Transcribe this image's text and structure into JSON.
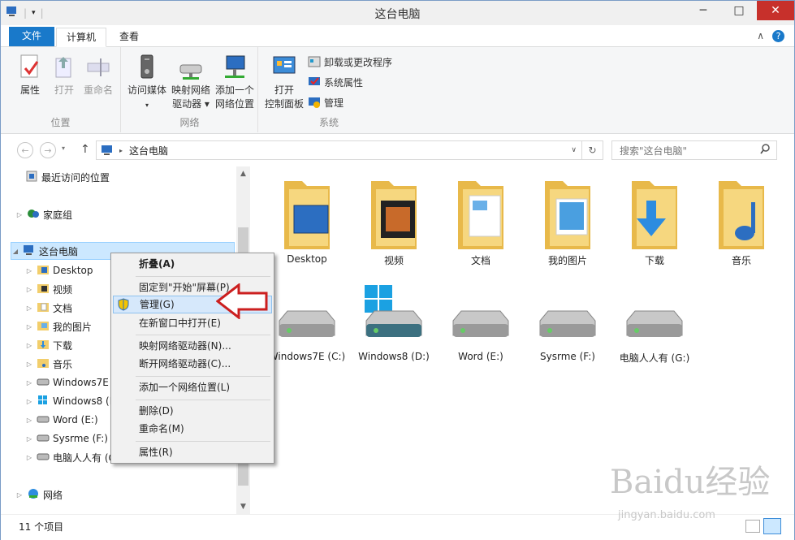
{
  "window": {
    "title": "这台电脑",
    "minimize": "─",
    "maximize": "□",
    "close": "✕"
  },
  "tabs": {
    "file": "文件",
    "computer": "计算机",
    "view": "查看",
    "collapse": "∧",
    "help": "?"
  },
  "ribbon": {
    "location": {
      "label": "位置",
      "properties": "属性",
      "open": "打开",
      "rename": "重命名"
    },
    "network": {
      "label": "网络",
      "media_line1": "访问媒体",
      "map_line1": "映射网络",
      "map_line2": "驱动器",
      "add_line1": "添加一个",
      "add_line2": "网络位置"
    },
    "system": {
      "label": "系统",
      "cp_line1": "打开",
      "cp_line2": "控制面板",
      "uninstall": "卸载或更改程序",
      "sysprops": "系统属性",
      "manage": "管理"
    }
  },
  "nav": {
    "path": "这台电脑",
    "search_placeholder": "搜索\"这台电脑\""
  },
  "tree": {
    "recent": "最近访问的位置",
    "homegroup": "家庭组",
    "thispc": "这台电脑",
    "desktop": "Desktop",
    "videos": "视频",
    "docs": "文档",
    "pictures": "我的图片",
    "downloads": "下载",
    "music": "音乐",
    "c": "Windows7E (",
    "d": "Windows8 (D",
    "e": "Word (E:)",
    "f": "Sysrme (F:)",
    "g": "电脑人人有 (G",
    "network": "网络"
  },
  "folders": [
    "Desktop",
    "视频",
    "文档",
    "我的图片",
    "下载",
    "音乐"
  ],
  "drives": [
    "Windows7E (C:)",
    "Windows8 (D:)",
    "Word (E:)",
    "Sysrme (F:)",
    "电脑人人有 (G:)"
  ],
  "context_menu": {
    "collapse": "折叠(A)",
    "pin": "固定到\"开始\"屏幕(P)",
    "manage": "管理(G)",
    "open_new": "在新窗口中打开(E)",
    "map_drive": "映射网络驱动器(N)...",
    "disconnect": "断开网络驱动器(C)...",
    "add_net": "添加一个网络位置(L)",
    "delete": "删除(D)",
    "rename": "重命名(M)",
    "properties": "属性(R)"
  },
  "status": {
    "count": "11 个项目"
  },
  "watermark": {
    "brand": "Baidu经验",
    "url": "jingyan.baidu.com"
  }
}
